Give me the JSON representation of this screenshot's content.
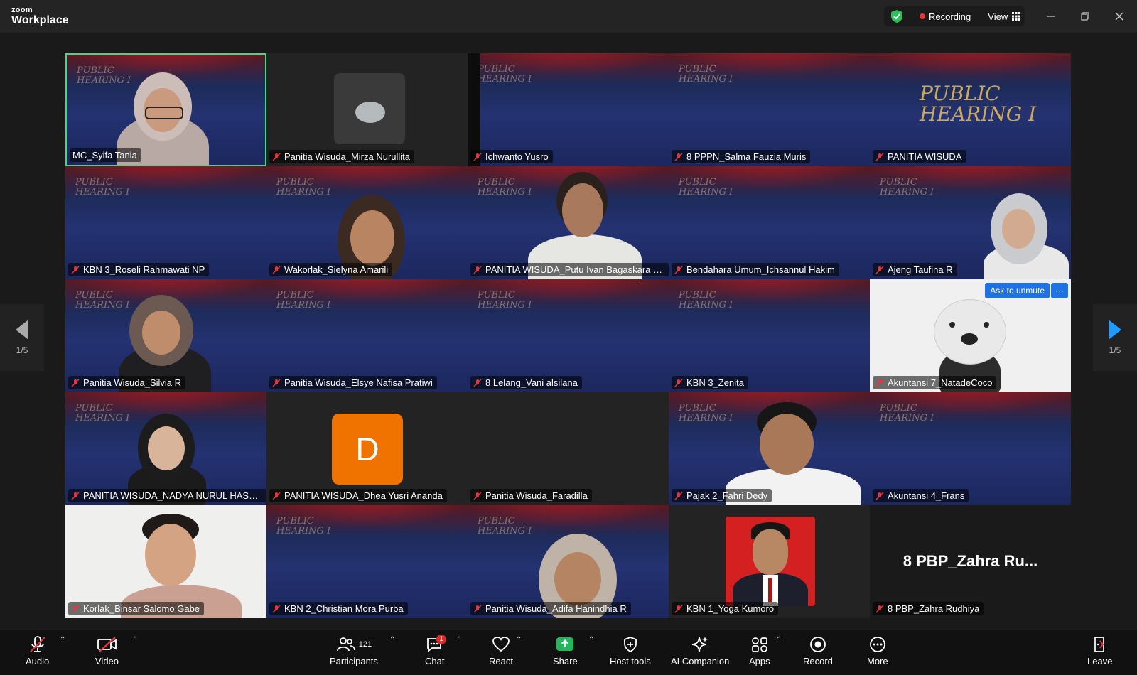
{
  "app": {
    "brand_small": "zoom",
    "brand_big": "Workplace"
  },
  "header": {
    "recording_label": "Recording",
    "view_label": "View"
  },
  "colors": {
    "active_border": "#3ddc84",
    "recording_dot": "#e8353b",
    "accent_blue": "#1f72e4",
    "avatar_orange": "#f07300",
    "mute_red": "#e8353b"
  },
  "watermark": {
    "line1": "PUBLIC",
    "line2": "HEARING I"
  },
  "participants": [
    {
      "name": "MC_Syifa Tania"
    },
    {
      "name": "Panitia Wisuda_Mirza Nurullita"
    },
    {
      "name": "Ichwanto Yusro"
    },
    {
      "name": "8 PPPN_Salma Fauzia Muris"
    },
    {
      "name": "PANITIA WISUDA"
    },
    {
      "name": "KBN 3_Roseli Rahmawati NP"
    },
    {
      "name": "Wakorlak_Sielyna Amarili"
    },
    {
      "name": "PANITIA WISUDA_Putu Ivan Bagaskara San..."
    },
    {
      "name": "Bendahara Umum_Ichsannul Hakim"
    },
    {
      "name": "Ajeng Taufina R"
    },
    {
      "name": "Panitia Wisuda_Silvia R"
    },
    {
      "name": "Panitia Wisuda_Elsye Nafisa Pratiwi"
    },
    {
      "name": "8 Lelang_Vani alsilana"
    },
    {
      "name": "KBN 3_Zenita"
    },
    {
      "name": "Akuntansi 7_NatadeCoco"
    },
    {
      "name": "PANITIA WISUDA_NADYA NURUL HASAN..."
    },
    {
      "name": "PANITIA WISUDA_Dhea Yusri Ananda",
      "avatar_letter": "D"
    },
    {
      "name": "Panitia Wisuda_Faradilla"
    },
    {
      "name": "Pajak 2_Fahri Dedy"
    },
    {
      "name": "Akuntansi 4_Frans"
    },
    {
      "name": "Korlak_Binsar Salomo Gabe"
    },
    {
      "name": "KBN 2_Christian Mora Purba"
    },
    {
      "name": "Panitia Wisuda_Adifa Hanindhia R"
    },
    {
      "name": "KBN 1_Yoga Kumoro"
    },
    {
      "name": "8 PBP_Zahra Rudhiya",
      "big_name": "8 PBP_Zahra Ru..."
    }
  ],
  "tile_actions": {
    "ask_to_unmute": "Ask to unmute",
    "more": "···"
  },
  "pager": {
    "left": "1/5",
    "right": "1/5"
  },
  "toolbar": {
    "audio": "Audio",
    "video": "Video",
    "participants": "Participants",
    "participants_count": "121",
    "chat": "Chat",
    "chat_badge": "1",
    "react": "React",
    "share": "Share",
    "host_tools": "Host tools",
    "ai_companion": "AI Companion",
    "apps": "Apps",
    "record": "Record",
    "more": "More",
    "leave": "Leave"
  }
}
